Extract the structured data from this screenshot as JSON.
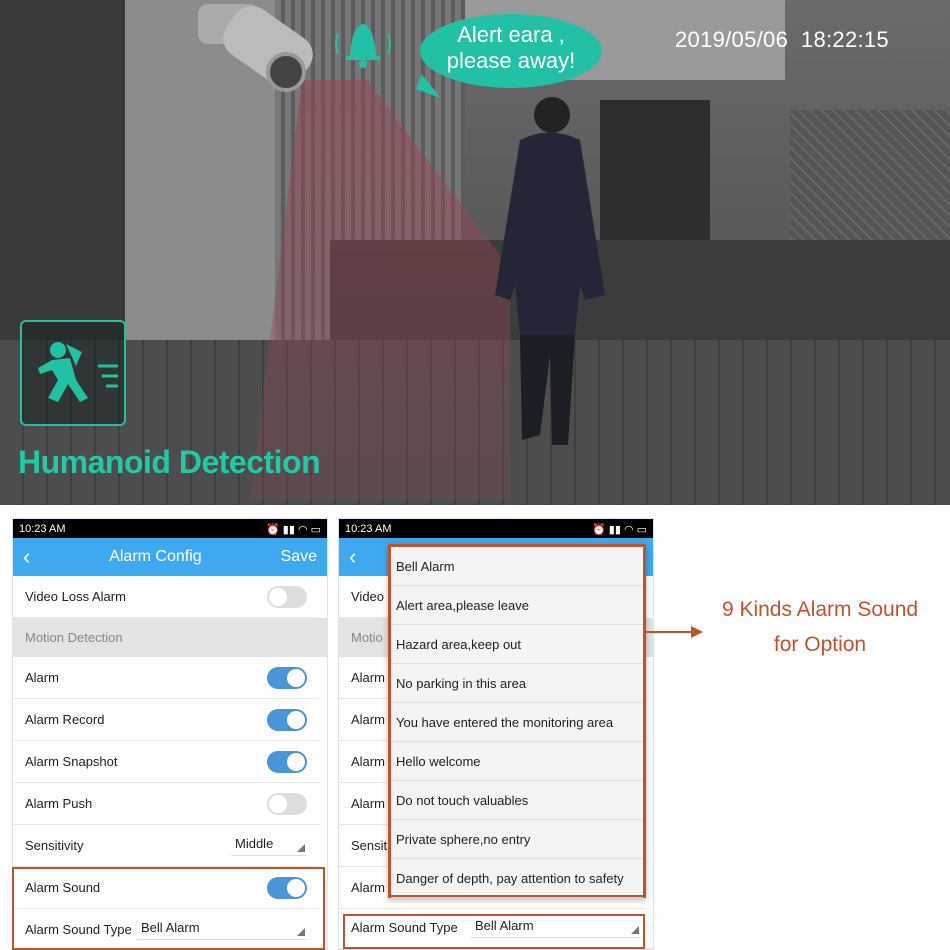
{
  "scene": {
    "speech": [
      "Alert eara ,",
      "please away!"
    ],
    "timestamp": "2019/05/06  18:22:15",
    "title": "Humanoid Detection",
    "accent": "#22c1a3"
  },
  "left_phone": {
    "status_time": "10:23 AM",
    "status_icons": [
      "alarm-icon",
      "signal-icon",
      "wifi-icon",
      "battery-icon"
    ],
    "title": "Alarm Config",
    "save": "Save",
    "rows": [
      {
        "label": "Video Loss Alarm",
        "type": "toggle",
        "on": false
      },
      {
        "label": "Motion Detection",
        "type": "section"
      },
      {
        "label": "Alarm",
        "type": "toggle",
        "on": true
      },
      {
        "label": "Alarm Record",
        "type": "toggle",
        "on": true
      },
      {
        "label": "Alarm Snapshot",
        "type": "toggle",
        "on": true
      },
      {
        "label": "Alarm Push",
        "type": "toggle",
        "on": false
      },
      {
        "label": "Sensitivity",
        "type": "select",
        "value": "Middle"
      },
      {
        "label": "Alarm Sound",
        "type": "toggle",
        "on": true
      },
      {
        "label": "Alarm Sound Type",
        "type": "select",
        "value": "Bell Alarm"
      }
    ]
  },
  "right_phone": {
    "status_time": "10:23 AM",
    "partial_rows": [
      "Video",
      "Motio",
      "Alarm",
      "Alarm",
      "Alarm",
      "Alarm",
      "Sensit",
      "Alarm"
    ],
    "sound_type_label": "Alarm Sound Type",
    "sound_type_value": "Bell Alarm",
    "options": [
      "Bell Alarm",
      "Alert area,please leave",
      "Hazard area,keep out",
      "No parking in this area",
      "You have entered the monitoring area",
      "Hello welcome",
      "Do not touch valuables",
      "Private sphere,no entry",
      "Danger of depth, pay attention to safety"
    ]
  },
  "note": [
    "9 Kinds Alarm Sound",
    "for Option"
  ],
  "colors": {
    "header_blue": "#3fa9f0",
    "toggle_on": "#4a95d8",
    "highlight": "#c0532c"
  }
}
